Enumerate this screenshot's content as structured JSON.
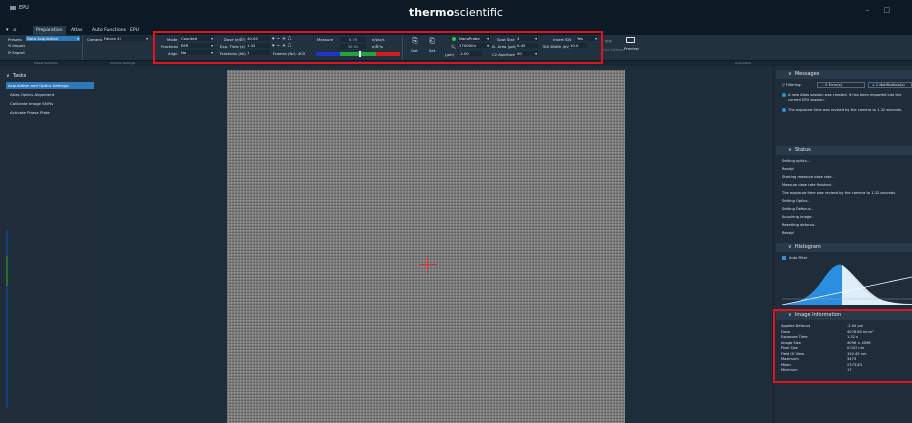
{
  "app": {
    "title": "EPU",
    "brand_prefix": "thermo",
    "brand_suffix": "scientific"
  },
  "window_controls": [
    "–",
    "□"
  ],
  "tabs": [
    "Preparation",
    "Atlas",
    "Auto Functions",
    "EPU"
  ],
  "ribbon": {
    "presets_label": "Presets",
    "presets_value": "Data Acquisition",
    "import_label": "Import",
    "export_label": "Export",
    "camera_label": "Camera",
    "camera_value": "Falcon 4i",
    "mode_label": "Mode",
    "mode_value": "Counted",
    "fractions_label": "Fractions",
    "fractions_value": "EER",
    "align_label": "Align",
    "align_value": "No",
    "dose_label": "Dose (e/Å²)",
    "dose_value": "40.00",
    "exptime_label": "Exp. Time (s)",
    "exptime_value": "1.32",
    "fractions_nr_label": "Fractions (Nr)",
    "fractions_nr_value": "1",
    "frames_label": "Frames (Nr): 405",
    "measure_label": "Measure",
    "dose_rate_1": "6.76",
    "dose_rate_1_unit": "e/pix/s",
    "dose_rate_2": "30.92",
    "dose_rate_2_unit": "e/Å²/s",
    "get_label": "Get",
    "set_label": "Set",
    "probe_value": "NanoProbe",
    "mag_value": "270000×",
    "defocus_label": "(µm)",
    "defocus_value": "-2.00",
    "spot_label": "Spot Size",
    "spot_value": "4",
    "illum_label": "Ill. Area (µm)",
    "illum_value": "0.45",
    "c2_label": "C2 Aperture",
    "c2_value": "50",
    "slit_label": "Insert Slit",
    "slit_value": "Yes",
    "slit_width_label": "Slit Width (eV)",
    "slit_width_value": "10.0",
    "link_label": "Link Settings",
    "preview_label": "Preview"
  },
  "group_labels": [
    "Preset Selection",
    "Camera Settings",
    "Acquisition"
  ],
  "tasks": {
    "header": "Tasks",
    "items": [
      "Acquisition and Optics Settings",
      "Atlas Optics Alignment",
      "Calibrate Image Shifts",
      "Activate Phase Plate"
    ]
  },
  "messages": {
    "header": "Messages",
    "filter_label": "Filtering:",
    "errors": "0 Error(s)",
    "notifications": "2 Notification(s)",
    "items": [
      "A new Atlas session was created. It has been imported into the",
      "current EPU session.",
      "The exposure time was revised by the camera to 1.32 seconds."
    ]
  },
  "status": {
    "header": "Status",
    "lines": [
      "Setting optics...",
      "Ready!",
      "Starting measure dose rate...",
      "Measure dose rate finished.",
      "The exposure time was revised by the camera to 1.32 seconds.",
      "Setting Optics..",
      "Setting Defocus..",
      "Acquiring image..",
      "Resetting defocus..",
      "Ready!"
    ]
  },
  "histogram": {
    "header": "Histogram",
    "auto_filter": "Auto Filter"
  },
  "image_info": {
    "header": "Image Information",
    "rows": [
      {
        "k": "Applied Defocus",
        "v": "-2.00 µm"
      },
      {
        "k": "Dose",
        "v": "4076.80 e/nm²"
      },
      {
        "k": "Exposure Time",
        "v": "1.32 s"
      },
      {
        "k": "Image Size",
        "v": "4096 × 4096"
      },
      {
        "k": "Pixel Size",
        "v": "0.047 nm"
      },
      {
        "k": "Field Of View",
        "v": "192.45 nm"
      },
      {
        "k": "Maximum",
        "v": "3473"
      },
      {
        "k": "Mean",
        "v": "2373.83"
      },
      {
        "k": "Minimum",
        "v": "17"
      }
    ]
  },
  "colors": {
    "accent": "#2e7ab8",
    "highlight": "#e0151c",
    "crosshair": "#e23232"
  }
}
